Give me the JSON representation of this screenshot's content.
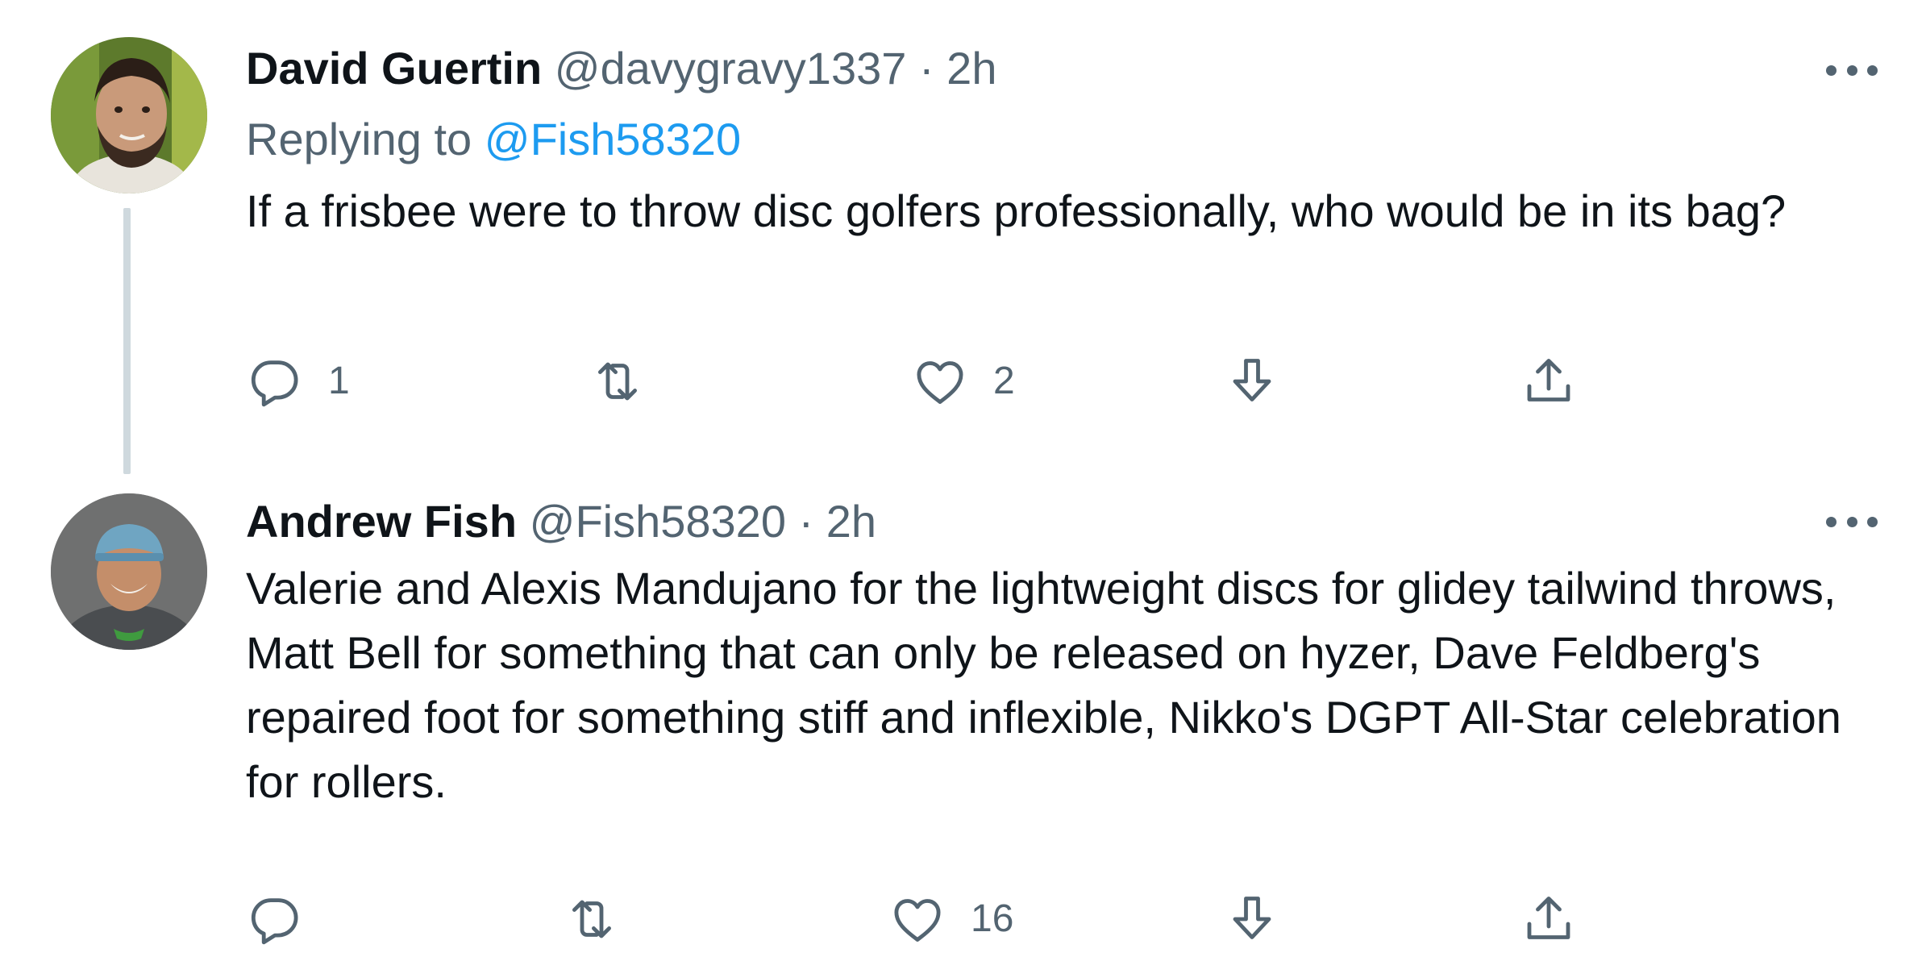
{
  "tweets": [
    {
      "name": "David Guertin",
      "handle": "@davygravy1337",
      "separator": "·",
      "time": "2h",
      "replying_prefix": "Replying to",
      "replying_to": "@Fish58320",
      "text": "If a frisbee were to throw disc golfers professionally, who would be in its bag?",
      "reply_count": "1",
      "retweet_count": "",
      "like_count": "2"
    },
    {
      "name": "Andrew Fish",
      "handle": "@Fish58320",
      "separator": "·",
      "time": "2h",
      "text": "Valerie and Alexis Mandujano for the lightweight discs for glidey tailwind throws, Matt Bell for something that can only be released on hyzer, Dave Feldberg's repaired foot for something stiff and inflexible, Nikko's DGPT All-Star celebration for rollers.",
      "reply_count": "",
      "retweet_count": "",
      "like_count": "16"
    }
  ],
  "icons": {
    "reply": "reply-icon",
    "retweet": "retweet-icon",
    "like": "heart-icon",
    "bookmark": "bookmark-download-icon",
    "share": "share-icon",
    "more": "more-options-icon"
  },
  "colors": {
    "text_primary": "#0f1419",
    "text_secondary": "#536471",
    "link": "#1d9bf0",
    "thread_line": "#cfd9de"
  }
}
